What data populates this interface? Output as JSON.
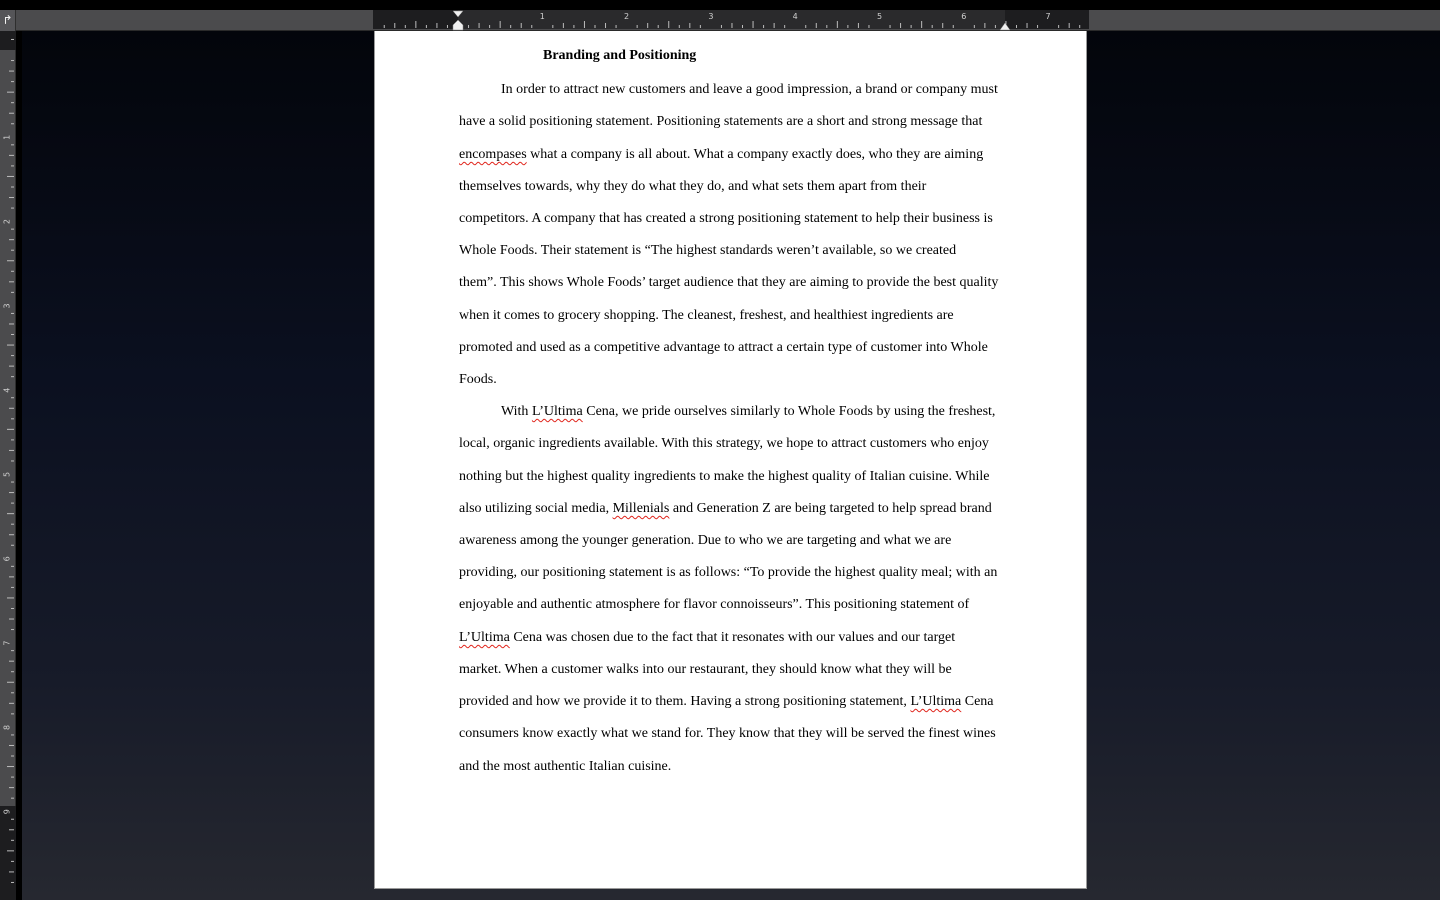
{
  "ruler": {
    "numbers": [
      "1",
      "2",
      "3",
      "4",
      "5",
      "6",
      "7"
    ],
    "vertical_numbers": [
      "1",
      "2",
      "3",
      "4",
      "5",
      "6",
      "7",
      "8",
      "9"
    ]
  },
  "icons": {
    "tab_selector": "left-tab-stop-icon",
    "first_line_indent": "first-line-indent-marker",
    "right_indent": "right-indent-marker"
  },
  "colors": {
    "spelling_underline": "#e0241b",
    "page_bg": "#ffffff",
    "ruler_bg": "#4b4b4d"
  },
  "document": {
    "title": "Branding and Positioning",
    "lines": [
      [
        {
          "t": "In order to attract new customers and leave a good impression, a brand or company must"
        }
      ],
      [
        {
          "t": "have a solid positioning statement.  Positioning statements are a short and strong message that"
        }
      ],
      [
        {
          "t": "encompases",
          "s": true
        },
        {
          "t": " what a company is all about.  What a company exactly does, who they are aiming"
        }
      ],
      [
        {
          "t": "themselves towards, why they do what they do, and what sets them apart from their"
        }
      ],
      [
        {
          "t": "competitors.  A company that has created a strong positioning statement to help their business is"
        }
      ],
      [
        {
          "t": "Whole Foods.  Their statement is “The highest standards weren’t available, so we created"
        }
      ],
      [
        {
          "t": "them”.  This shows Whole Foods’ target audience that they are aiming to provide the best quality"
        }
      ],
      [
        {
          "t": "when it comes to grocery shopping.  The cleanest, freshest, and healthiest ingredients are"
        }
      ],
      [
        {
          "t": "promoted and used as a competitive advantage to attract a certain type of customer into Whole"
        }
      ],
      [
        {
          "t": "Foods."
        }
      ],
      [
        {
          "t": "With "
        },
        {
          "t": "L’Ultima",
          "s": true
        },
        {
          "t": " Cena, we pride ourselves similarly to Whole Foods by using the freshest,"
        }
      ],
      [
        {
          "t": "local, organic ingredients available.  With this strategy, we hope to attract customers who enjoy"
        }
      ],
      [
        {
          "t": "nothing but the highest quality ingredients to make the highest quality of Italian cuisine.  While"
        }
      ],
      [
        {
          "t": "also utilizing social media, "
        },
        {
          "t": "Millenials",
          "s": true
        },
        {
          "t": " and Generation Z are being targeted to help spread brand"
        }
      ],
      [
        {
          "t": "awareness among the younger generation.  Due to who we are targeting and what we are"
        }
      ],
      [
        {
          "t": "providing, our positioning statement is as follows: “To provide the highest quality meal; with an"
        }
      ],
      [
        {
          "t": "enjoyable and authentic atmosphere for flavor connoisseurs”.  This positioning statement of"
        }
      ],
      [
        {
          "t": "L’Ultima",
          "s": true
        },
        {
          "t": " Cena was chosen due to the fact that it resonates with our values and our target"
        }
      ],
      [
        {
          "t": "market.  When a customer walks into our restaurant, they should know what they will be"
        }
      ],
      [
        {
          "t": "provided and how we provide it to them.  Having a strong positioning statement, "
        },
        {
          "t": "L’Ultima",
          "s": true
        },
        {
          "t": " Cena"
        }
      ],
      [
        {
          "t": "consumers know exactly what we stand for.  They know that they will be served the finest wines"
        }
      ],
      [
        {
          "t": "and the most authentic Italian cuisine."
        }
      ]
    ]
  }
}
